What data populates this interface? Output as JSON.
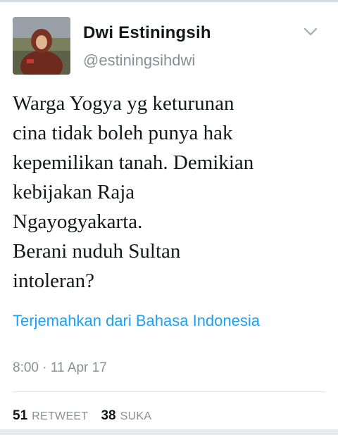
{
  "tweet": {
    "author": {
      "display_name": "Dwi Estiningsih",
      "handle": "@estiningsihdwi",
      "avatar_icon": "user-avatar-photo"
    },
    "menu_icon": "chevron-down-icon",
    "text": "Warga Yogya yg keturunan\ncina tidak boleh punya hak\nkepemilikan tanah. Demikian\nkebijakan Raja\nNgayogyakarta.\nBerani nuduh Sultan\nintoleran?",
    "translate_label": "Terjemahkan dari Bahasa Indonesia",
    "timestamp": "8:00 · 11 Apr 17",
    "stats": {
      "retweet_count": "51",
      "retweet_label": "RETWEET",
      "like_count": "38",
      "like_label": "SUKA"
    }
  },
  "colors": {
    "link": "#1da1f2",
    "secondary_text": "#8a8f96",
    "primary_text": "#14171a"
  }
}
